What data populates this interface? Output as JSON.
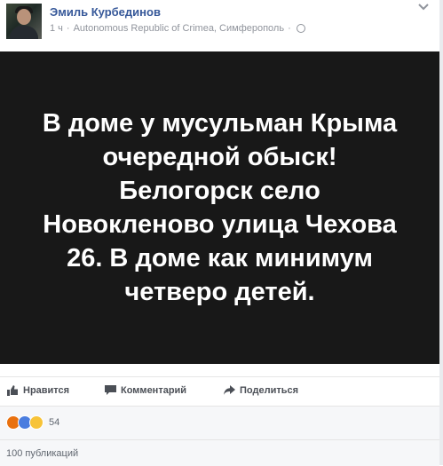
{
  "post": {
    "author": "Эмиль Курбединов",
    "time": "1 ч",
    "location": "Autonomous Republic of Crimea, Симферополь",
    "separator": "·",
    "image_text": [
      "В доме у мусульман Крыма",
      "очередной обыск!",
      "Белогорск село",
      "Новокленово улица Чехова",
      "26. В доме как минимум",
      "четверо детей."
    ]
  },
  "actions": {
    "like_label": "Нравится",
    "comment_label": "Комментарий",
    "share_label": "Поделиться"
  },
  "reactions": {
    "types": [
      "angry",
      "like",
      "sad"
    ],
    "count": "54"
  },
  "shares": {
    "label": "100 публикаций"
  },
  "colors": {
    "author_link": "#365899",
    "image_background": "#181818",
    "meta_text": "#90949c"
  }
}
